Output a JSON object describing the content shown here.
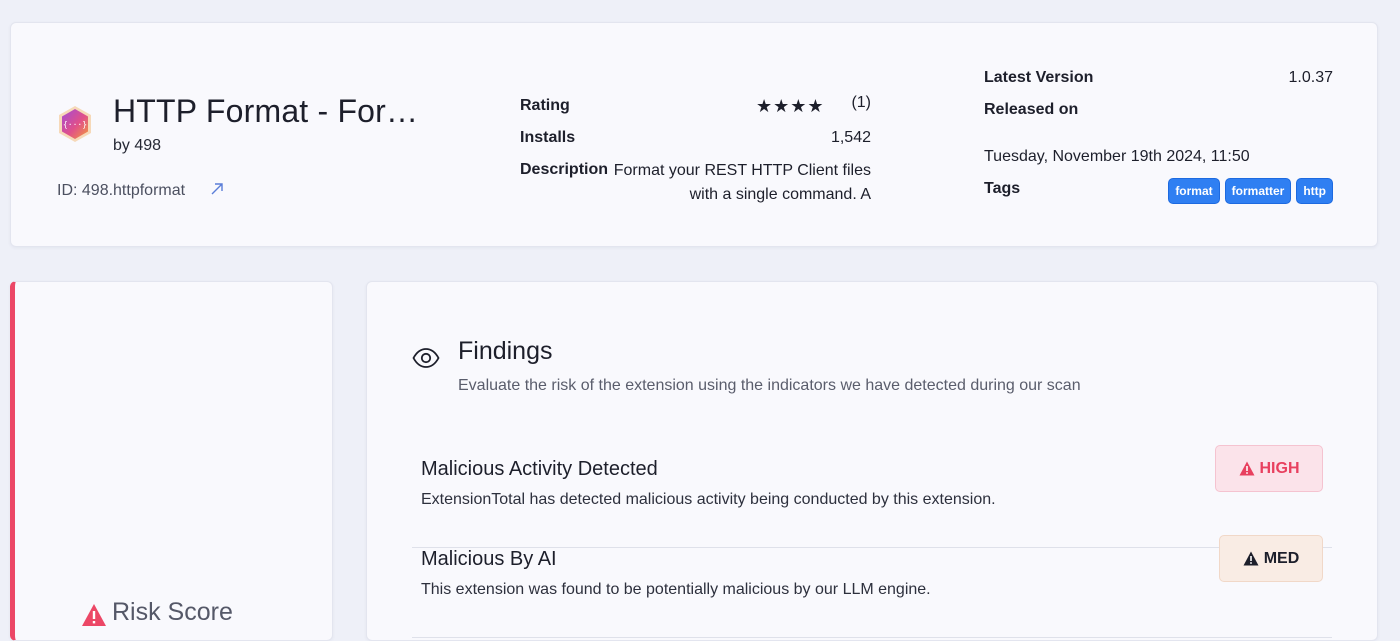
{
  "extension": {
    "title": "HTTP Format - For…",
    "author": "by 498",
    "id": "ID: 498.httpformat",
    "icon": "http-format-hexagon-icon"
  },
  "metadata": {
    "rating_label": "Rating",
    "rating_stars": "★★★★",
    "rating_value": 4,
    "rating_count": "(1)",
    "installs_label": "Installs",
    "installs_value": "1,542",
    "description_label": "Description",
    "description_value": "Format your REST HTTP Client files with a single command. A",
    "latest_version_label": "Latest Version",
    "latest_version_value": "1.0.37",
    "released_label": "Released on",
    "released_value": "Tuesday, November 19th 2024, 11:50",
    "tags_label": "Tags",
    "tags": [
      "format",
      "formatter",
      "http"
    ]
  },
  "risk": {
    "label": "Risk Score"
  },
  "findings": {
    "title": "Findings",
    "subtitle": "Evaluate the risk of the extension using the indicators we have detected during our scan",
    "items": [
      {
        "title": "Malicious Activity Detected",
        "description": "ExtensionTotal has detected malicious activity being conducted by this extension.",
        "severity": "HIGH"
      },
      {
        "title": "Malicious By AI",
        "description": "This extension was found to be potentially malicious by our LLM engine.",
        "severity": "MED"
      }
    ]
  },
  "colors": {
    "accent_red": "#ec4766",
    "tag_blue": "#2f7ff2",
    "high_text": "#e8405f"
  }
}
